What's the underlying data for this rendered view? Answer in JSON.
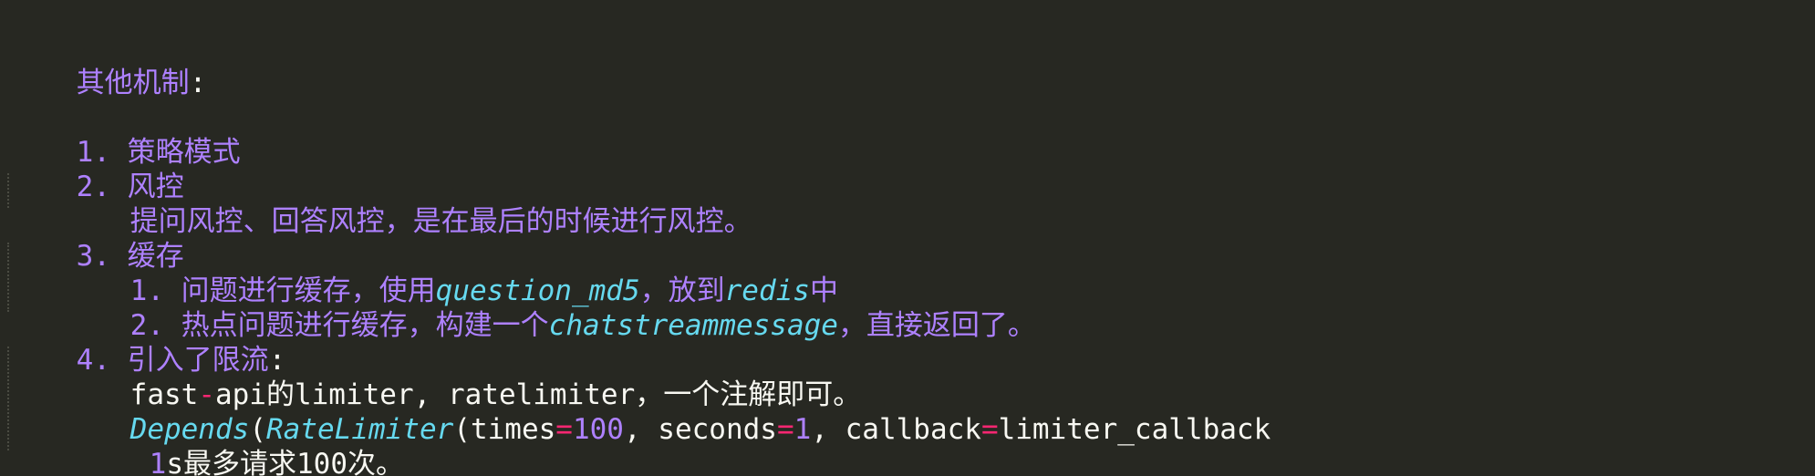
{
  "heading": {
    "text": "其他机制",
    "colon": ":"
  },
  "items": [
    {
      "number": "1.",
      "title": "策略模式"
    },
    {
      "number": "2.",
      "title": "风控",
      "detail": "提问风控、回答风控，是在最后的时候进行风控。"
    },
    {
      "number": "3.",
      "title": "缓存",
      "subitems": [
        {
          "number": "1.",
          "before": "问题进行缓存，使用",
          "code": "question_md5",
          "middle": "，放到",
          "code2": "redis",
          "after": "中"
        },
        {
          "number": "2.",
          "before": "热点问题进行缓存，构建一个",
          "code": "chatstreammessage",
          "after": "，直接返回了。"
        }
      ]
    },
    {
      "number": "4.",
      "title": "引入了限流",
      "colon": ":",
      "line1": {
        "a": "fast",
        "dash": "-",
        "b": "api的limiter, ratelimiter，一个注解即可。"
      },
      "line2": {
        "fn": "Depends",
        "paren": "(",
        "cls": "RateLimiter",
        "paren2": "(",
        "arg1": "times",
        "eq": "=",
        "val1": "100",
        "sep1": ", ",
        "arg2": "seconds",
        "val2": "1",
        "sep2": ", ",
        "arg3": "callback",
        "val3": "limiter_callback"
      },
      "line3": {
        "num": "1",
        "rest": "s最多请求100次。"
      }
    }
  ],
  "colors": {
    "background": "#272822",
    "purple": "#ae81ff",
    "cyan": "#66d9ef",
    "pink": "#f92672",
    "text": "#f8f8f2"
  }
}
